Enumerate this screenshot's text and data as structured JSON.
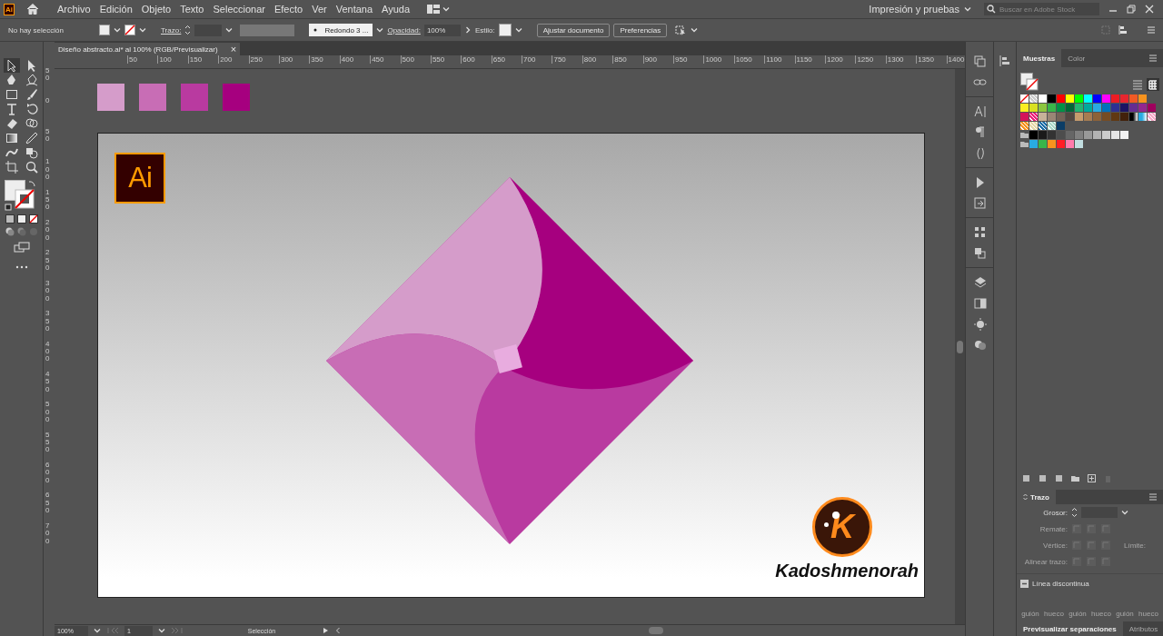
{
  "app_logo": "Ai",
  "menu": [
    "Archivo",
    "Edición",
    "Objeto",
    "Texto",
    "Seleccionar",
    "Efecto",
    "Ver",
    "Ventana",
    "Ayuda"
  ],
  "workspace": "Impresión y pruebas",
  "stock_search": {
    "placeholder": "Buscar en Adobe Stock"
  },
  "control_bar": {
    "selection": "No hay selección",
    "stroke_label": "Trazo:",
    "brush": "Redondo 3 ...",
    "opacity_label": "Opacidad:",
    "opacity": "100%",
    "style_label": "Estilo:",
    "buttons": [
      "Ajustar documento",
      "Preferencias"
    ]
  },
  "document_tab": {
    "title": "Diseño abstracto.ai* al 100% (RGB/Previsualizar)",
    "close": "×"
  },
  "rulers": {
    "horizontal": [
      "50",
      "100",
      "150",
      "200",
      "250",
      "300",
      "350",
      "400",
      "450",
      "500",
      "550",
      "600",
      "650",
      "700",
      "750",
      "800",
      "850",
      "900",
      "950",
      "1000",
      "1050",
      "1100",
      "1150",
      "1200",
      "1250",
      "1300",
      "1350",
      "1400"
    ],
    "vertical": [
      "50",
      "0",
      "50",
      "100",
      "150",
      "200",
      "250",
      "300",
      "350",
      "400",
      "450",
      "500",
      "550",
      "600",
      "650",
      "700"
    ]
  },
  "canvas_swatches": [
    {
      "color": "#d59cca"
    },
    {
      "color": "#c86db5"
    },
    {
      "color": "#b93aa0"
    },
    {
      "color": "#a6007f"
    }
  ],
  "artboard": {
    "logo": "Ai",
    "brand_initial": "K",
    "brand": "Kadoshmenorah"
  },
  "swatches_panel": {
    "tabs": [
      {
        "label": "Muestras",
        "selected": true
      },
      {
        "label": "Color",
        "selected": false
      }
    ],
    "rows": [
      [
        {
          "kind": "none"
        },
        {
          "kind": "pattern",
          "color": "#cccccc"
        },
        {
          "color": "#ffffff"
        },
        {
          "color": "#000000"
        },
        {
          "color": "#ff0000"
        },
        {
          "color": "#ffff00"
        },
        {
          "color": "#00ff00"
        },
        {
          "color": "#00ffff"
        },
        {
          "color": "#0000ff"
        },
        {
          "color": "#ff00ff"
        },
        {
          "color": "#ed1c24"
        },
        {
          "color": "#e8262e"
        },
        {
          "color": "#f15a24"
        },
        {
          "color": "#f7931e"
        }
      ],
      [
        {
          "color": "#fcee21"
        },
        {
          "color": "#d9e021"
        },
        {
          "color": "#8cc63f"
        },
        {
          "color": "#39b54a"
        },
        {
          "color": "#009245"
        },
        {
          "color": "#006837"
        },
        {
          "color": "#22b573"
        },
        {
          "color": "#00a99d"
        },
        {
          "color": "#29abe2"
        },
        {
          "color": "#0071bc"
        },
        {
          "color": "#2e3192"
        },
        {
          "color": "#1b1464"
        },
        {
          "color": "#662d91"
        },
        {
          "color": "#93278f"
        },
        {
          "color": "#9e005d"
        }
      ],
      [
        {
          "color": "#d4145a"
        },
        {
          "kind": "pattern",
          "color": "#ed1e79"
        },
        {
          "color": "#c7b299"
        },
        {
          "color": "#998675"
        },
        {
          "color": "#736357"
        },
        {
          "color": "#534741"
        },
        {
          "color": "#c69c6d"
        },
        {
          "color": "#a67c52"
        },
        {
          "color": "#8c6239"
        },
        {
          "color": "#754c24"
        },
        {
          "color": "#603813"
        },
        {
          "color": "#42210b"
        },
        {
          "kind": "gradient",
          "color": "#000000"
        },
        {
          "kind": "gradient",
          "color": "#29abe2"
        },
        {
          "kind": "pattern",
          "color": "#f7a8c8"
        }
      ],
      [
        {
          "kind": "pattern",
          "color": "#f7931e"
        },
        {
          "kind": "pattern",
          "color": "#e6d9a8"
        },
        {
          "kind": "pattern",
          "color": "#1d6fa8"
        },
        {
          "kind": "pattern",
          "color": "#a8d8c8"
        },
        {
          "color": "#0b3d66"
        }
      ],
      [
        {
          "kind": "folder"
        },
        {
          "color": "#000000"
        },
        {
          "color": "#1a1a1a"
        },
        {
          "color": "#333333"
        },
        {
          "color": "#4d4d4d"
        },
        {
          "color": "#666666"
        },
        {
          "color": "#808080"
        },
        {
          "color": "#999999"
        },
        {
          "color": "#b3b3b3"
        },
        {
          "color": "#cccccc"
        },
        {
          "color": "#e6e6e6"
        },
        {
          "color": "#f2f2f2"
        }
      ],
      [
        {
          "kind": "folder"
        },
        {
          "color": "#29abe2"
        },
        {
          "color": "#39b54a"
        },
        {
          "color": "#f7931e"
        },
        {
          "color": "#ff1d25"
        },
        {
          "color": "#ff7bac"
        },
        {
          "color": "#c1dde0"
        }
      ]
    ]
  },
  "stroke_panel": {
    "title": "Trazo",
    "weight_label": "Grosor:",
    "cap_label": "Remate:",
    "corner_label": "Vértice:",
    "limit_label": "Límite:",
    "align_label": "Alinear trazo:",
    "dashed_label": "Línea discontinua",
    "dash_fields": [
      "guión",
      "hueco",
      "guión",
      "hueco",
      "guión",
      "hueco"
    ]
  },
  "bottom_tabs": [
    {
      "label": "Previsualizar separaciones",
      "selected": true
    },
    {
      "label": "Atributos",
      "selected": false
    }
  ],
  "status_bar": {
    "zoom": "100%",
    "artboard": "1",
    "tool": "Selección"
  }
}
